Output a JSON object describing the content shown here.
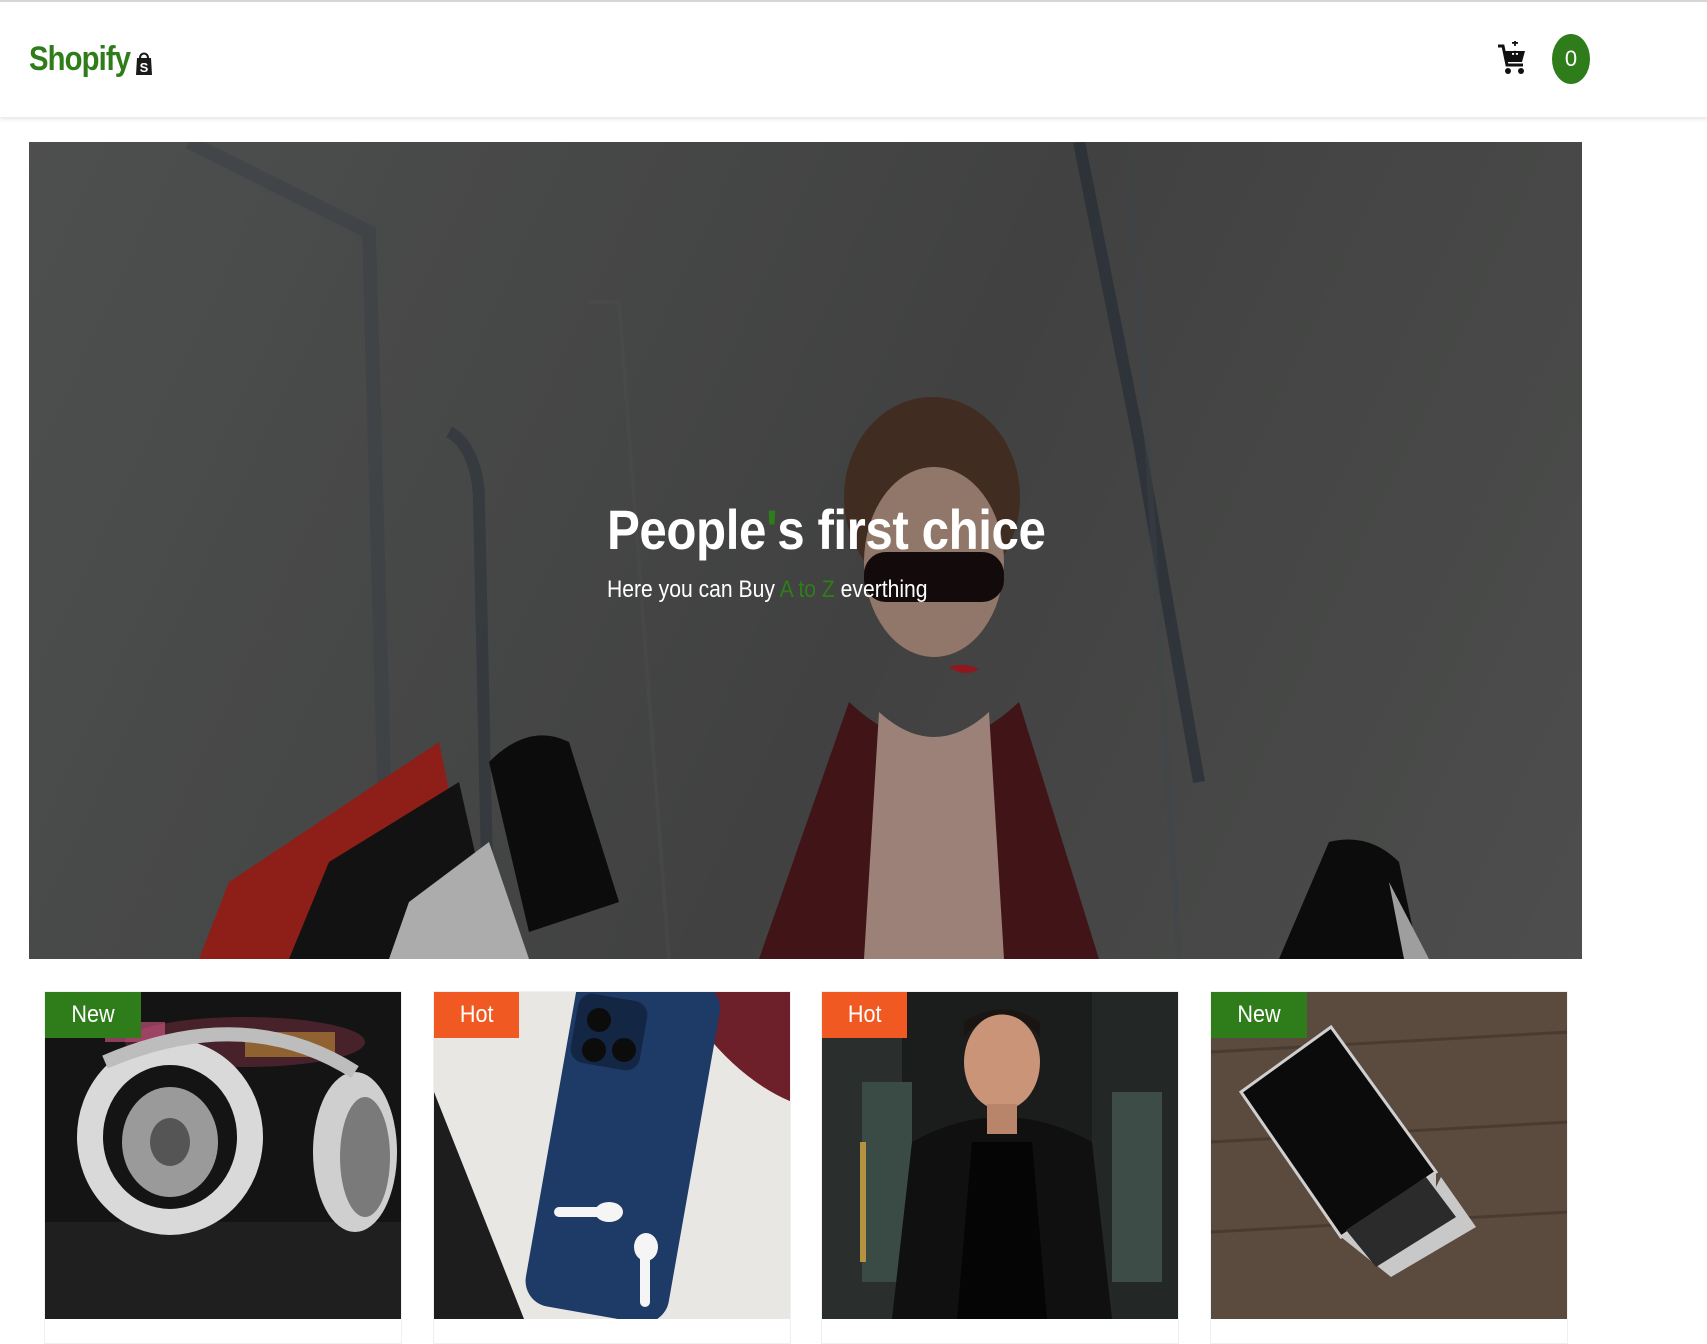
{
  "navbar": {
    "brand": "Shopify",
    "brand_icon": "shopify-bag-icon",
    "cart_icon": "cart-plus-icon",
    "cart_count": "0"
  },
  "hero": {
    "title_before": "People",
    "title_apostrophe": "'",
    "title_after": "s first chice",
    "subtitle_before": "Here you can Buy ",
    "subtitle_highlight": "A to Z",
    "subtitle_after": " everthing"
  },
  "products": [
    {
      "badge": "New",
      "badge_color": "#2e7d1a",
      "image": "headphones"
    },
    {
      "badge": "Hot",
      "badge_color": "#f05a22",
      "image": "phone-and-earbuds"
    },
    {
      "badge": "Hot",
      "badge_color": "#f05a22",
      "image": "man-leather-jacket"
    },
    {
      "badge": "New",
      "badge_color": "#2e7d1a",
      "image": "laptop"
    }
  ],
  "colors": {
    "brand_green": "#2e7d1a",
    "hot_orange": "#f05a22"
  }
}
